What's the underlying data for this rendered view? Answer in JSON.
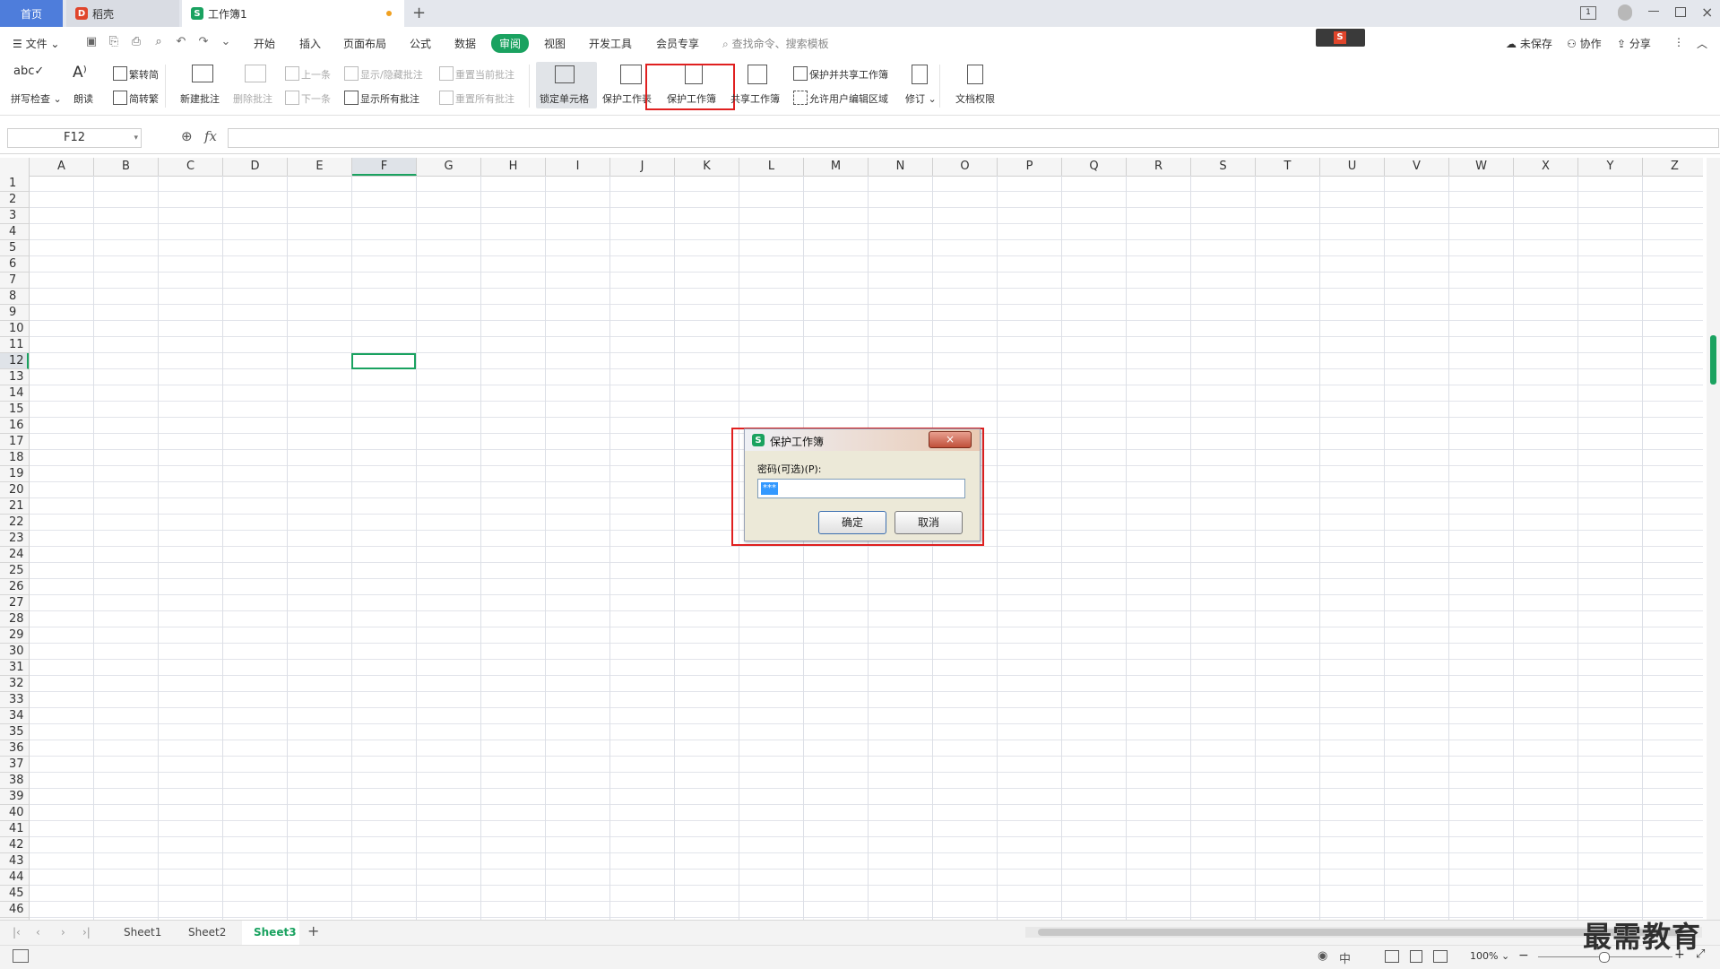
{
  "tabs": {
    "home": "首页",
    "daoke": "稻壳",
    "workbook": "工作簿1"
  },
  "menu": {
    "file": "文件",
    "items": [
      "开始",
      "插入",
      "页面布局",
      "公式",
      "数据",
      "审阅",
      "视图",
      "开发工具",
      "会员专享"
    ],
    "active": "审阅",
    "search_placeholder": "查找命令、搜索模板",
    "unsaved": "未保存",
    "collab": "协作",
    "share": "分享"
  },
  "ribbon": {
    "spell": "拼写检查",
    "read": "朗读",
    "trad": "繁转简",
    "simp": "简转繁",
    "new_comment": "新建批注",
    "del_comment": "删除批注",
    "prev": "上一条",
    "next": "下一条",
    "show_hide": "显示/隐藏批注",
    "show_all": "显示所有批注",
    "reset_cur": "重置当前批注",
    "reset_all": "重置所有批注",
    "lock_cell": "锁定单元格",
    "protect_sheet": "保护工作表",
    "protect_book": "保护工作簿",
    "share_book": "共享工作簿",
    "protect_share": "保护并共享工作簿",
    "allow_edit": "允许用户编辑区域",
    "revise": "修订",
    "doc_perm": "文档权限"
  },
  "formula_bar": {
    "cell_ref": "F12",
    "fx": "fx",
    "value": ""
  },
  "columns": [
    "A",
    "B",
    "C",
    "D",
    "E",
    "F",
    "G",
    "H",
    "I",
    "J",
    "K",
    "L",
    "M",
    "N",
    "O",
    "P",
    "Q",
    "R",
    "S",
    "T",
    "U",
    "V",
    "W",
    "X",
    "Y",
    "Z"
  ],
  "selected_column": "F",
  "selected_row": "12",
  "rows": [
    "1",
    "2",
    "3",
    "4",
    "5",
    "6",
    "7",
    "8",
    "9",
    "10",
    "11",
    "12",
    "13",
    "14",
    "15",
    "16",
    "17",
    "18",
    "19",
    "20",
    "21",
    "22",
    "23",
    "24",
    "25",
    "26",
    "27",
    "28",
    "29",
    "30",
    "31",
    "32",
    "33",
    "34",
    "35",
    "36",
    "37",
    "38",
    "39",
    "40",
    "41",
    "42",
    "43",
    "44",
    "45",
    "46"
  ],
  "sheets": [
    "Sheet1",
    "Sheet2",
    "Sheet3"
  ],
  "active_sheet": "Sheet3",
  "status": {
    "zoom": "100%"
  },
  "dialog": {
    "title": "保护工作簿",
    "label": "密码(可选)(P):",
    "password_value": "***",
    "ok": "确定",
    "cancel": "取消"
  },
  "watermark": "最需教育",
  "colors": {
    "accent": "#1aa260",
    "home_tab": "#4e7ddb",
    "highlight": "#e02020"
  }
}
